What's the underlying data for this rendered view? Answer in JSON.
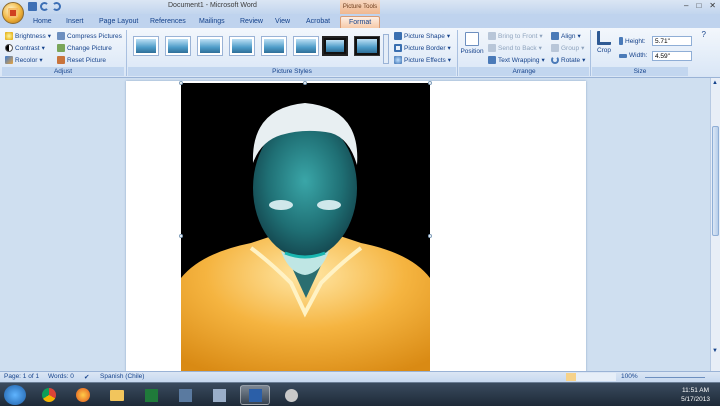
{
  "window": {
    "title": "Document1 - Microsoft Word",
    "context_title": "Picture Tools"
  },
  "tabs": [
    {
      "label": "Home"
    },
    {
      "label": "Insert"
    },
    {
      "label": "Page Layout"
    },
    {
      "label": "References"
    },
    {
      "label": "Mailings"
    },
    {
      "label": "Review"
    },
    {
      "label": "View"
    },
    {
      "label": "Acrobat"
    },
    {
      "label": "Format"
    }
  ],
  "ribbon": {
    "adjust": {
      "label": "Adjust",
      "brightness": "Brightness",
      "contrast": "Contrast",
      "recolor": "Recolor",
      "compress": "Compress Pictures",
      "change": "Change Picture",
      "reset": "Reset Picture"
    },
    "styles": {
      "label": "Picture Styles",
      "shape": "Picture Shape",
      "border": "Picture Border",
      "effects": "Picture Effects"
    },
    "arrange": {
      "label": "Arrange",
      "position": "Position",
      "bring_front": "Bring to Front",
      "send_back": "Send to Back",
      "text_wrapping": "Text Wrapping",
      "align": "Align",
      "group": "Group",
      "rotate": "Rotate"
    },
    "size": {
      "label": "Size",
      "crop": "Crop",
      "height_label": "Height:",
      "height_value": "5.71\"",
      "width_label": "Width:",
      "width_value": "4.59\""
    }
  },
  "status": {
    "page": "Page: 1 of 1",
    "words": "Words: 0",
    "language": "Spanish (Chile)",
    "zoom": "100%"
  },
  "tray": {
    "time": "11:51 AM",
    "date": "5/17/2013"
  },
  "colors": {
    "accent": "#15428b",
    "context_tab": "#f0b890",
    "shirt": "#f5a623",
    "face": "#1f6f74"
  }
}
